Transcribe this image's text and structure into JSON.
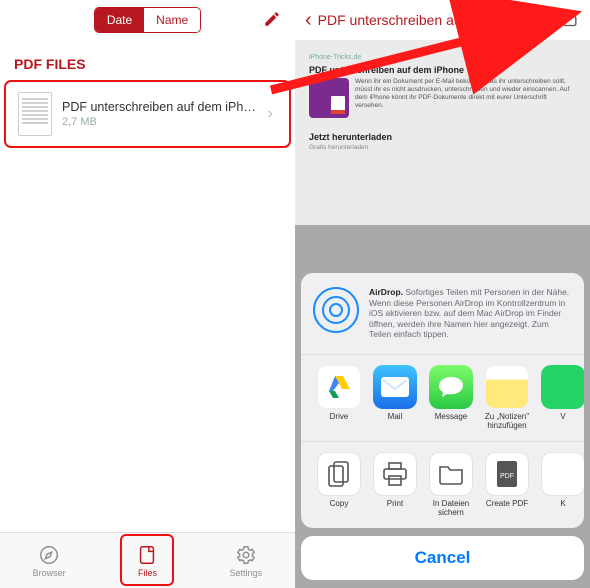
{
  "left": {
    "segmented": {
      "date": "Date",
      "name": "Name"
    },
    "section_header": "PDF FILES",
    "file": {
      "title": "PDF unterschreiben auf dem iPhone....",
      "size": "2,7 MB"
    },
    "tabs": {
      "browser": "Browser",
      "files": "Files",
      "settings": "Settings"
    }
  },
  "right": {
    "title": "PDF unterschreiben auf dem iPhone...",
    "preview": {
      "site": "iPhone-Tricks.de",
      "headline": "PDF unterschreiben auf dem iPhone",
      "blurb": "Wenn ihr ein Dokument per E-Mail bekommt, das ihr unterschreiben sollt, müsst ihr es nicht ausdrucken, unterschreiben und wieder einscannen. Auf dem iPhone könnt ihr PDF-Dokumente direkt mit eurer Unterschrift versehen.",
      "dl_head": "Jetzt herunterladen",
      "dl_blurb": "Gratis herunterladen"
    },
    "airdrop": {
      "bold": "AirDrop.",
      "text": " Sofortiges Teilen mit Personen in der Nähe. Wenn diese Personen AirDrop im Kontrollzentrum in iOS aktivieren bzw. auf dem Mac AirDrop im Finder öffnen, werden ihre Namen hier angezeigt. Zum Teilen einfach tippen."
    },
    "apps_row": [
      {
        "name": "drive",
        "label": "Drive"
      },
      {
        "name": "mail",
        "label": "Mail"
      },
      {
        "name": "message",
        "label": "Message"
      },
      {
        "name": "notes",
        "label": "Zu „Notizen\" hinzufügen"
      },
      {
        "name": "whatsapp",
        "label": "V"
      }
    ],
    "actions_row": [
      {
        "name": "copy",
        "label": "Copy"
      },
      {
        "name": "print",
        "label": "Print"
      },
      {
        "name": "save-files",
        "label": "In Dateien sichern"
      },
      {
        "name": "create-pdf",
        "label": "Create PDF"
      },
      {
        "name": "more",
        "label": "K"
      }
    ],
    "cancel": "Cancel"
  }
}
